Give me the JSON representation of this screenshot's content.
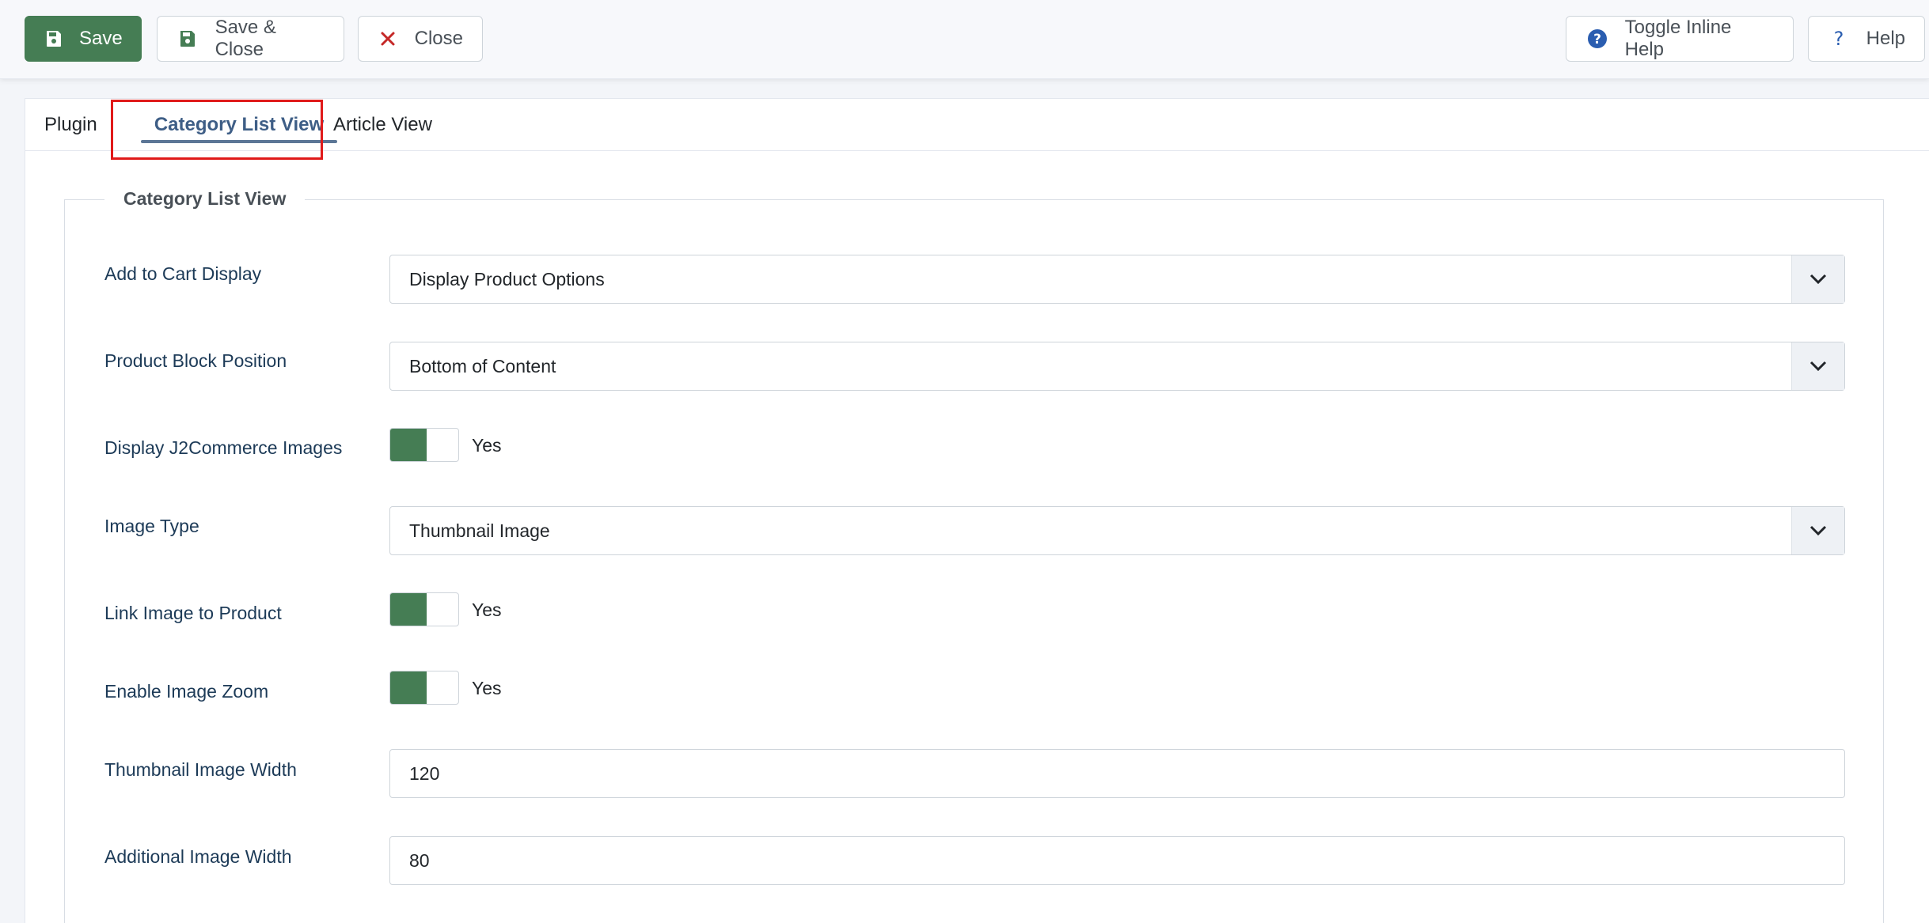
{
  "toolbar": {
    "save_label": "Save",
    "save_close_label": "Save & Close",
    "close_label": "Close",
    "toggle_help_label": "Toggle Inline Help",
    "help_label": "Help"
  },
  "tabs": [
    {
      "label": "Plugin"
    },
    {
      "label": "Category List View"
    },
    {
      "label": "Article View"
    }
  ],
  "fieldset": {
    "legend": "Category List View",
    "fields": {
      "add_to_cart": {
        "label": "Add to Cart Display",
        "value": "Display Product Options"
      },
      "block_position": {
        "label": "Product Block Position",
        "value": "Bottom of Content"
      },
      "display_images": {
        "label": "Display J2Commerce Images",
        "value": "Yes"
      },
      "image_type": {
        "label": "Image Type",
        "value": "Thumbnail Image"
      },
      "link_image": {
        "label": "Link Image to Product",
        "value": "Yes"
      },
      "image_zoom": {
        "label": "Enable Image Zoom",
        "value": "Yes"
      },
      "thumb_width": {
        "label": "Thumbnail Image Width",
        "value": "120"
      },
      "additional_width": {
        "label": "Additional Image Width",
        "value": "80"
      }
    }
  },
  "icons": {
    "save": "floppy-disk-icon",
    "close": "x-icon",
    "toggle_help": "question-circle-icon",
    "help": "question-icon",
    "caret": "chevron-down-icon"
  },
  "colors": {
    "primary_green": "#457d54",
    "tab_active": "#3e5e86",
    "highlight_red": "#e01a1a",
    "close_red": "#c52827",
    "help_blue": "#2a5db0"
  }
}
